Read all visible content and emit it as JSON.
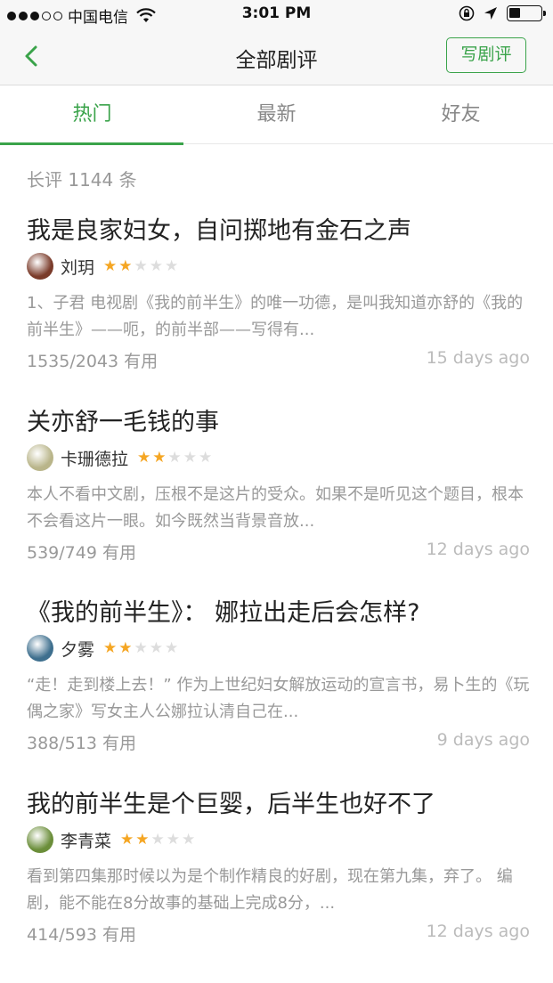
{
  "status_bar": {
    "carrier": "中国电信",
    "time": "3:01 PM",
    "battery_level": 0.35
  },
  "nav": {
    "title": "全部剧评",
    "write_label": "写剧评",
    "back_icon": "chevron-left-icon"
  },
  "tabs": [
    {
      "label": "热门"
    },
    {
      "label": "最新"
    },
    {
      "label": "好友"
    }
  ],
  "review_count": "长评 1144 条",
  "reviews": [
    {
      "title": "我是良家妇女，自问掷地有金石之声",
      "author": "刘玥",
      "rating": 2,
      "snippet": "1、子君 电视剧《我的前半生》的唯一功德，是叫我知道亦舒的《我的前半生》——呃，的前半部——写得有...",
      "useful": "1535/2043 有用",
      "time": "15 days ago",
      "avatar_color": "#7a3b2a"
    },
    {
      "title": "关亦舒一毛钱的事",
      "author": "卡珊德拉",
      "rating": 2,
      "snippet": "本人不看中文剧，压根不是这片的受众。如果不是听见这个题目，根本不会看这片一眼。如今既然当背景音放...",
      "useful": "539/749 有用",
      "time": "12 days ago",
      "avatar_color": "#b9b58a"
    },
    {
      "title": "《我的前半生》： 娜拉出走后会怎样?",
      "author": "夕雾",
      "rating": 2,
      "snippet": "“走！走到楼上去！” 作为上世纪妇女解放运动的宣言书，易卜生的《玩偶之家》写女主人公娜拉认清自己在...",
      "useful": "388/513 有用",
      "time": "9 days ago",
      "avatar_color": "#3e6f8e"
    },
    {
      "title": "我的前半生是个巨婴，后半生也好不了",
      "author": "李青菜",
      "rating": 2,
      "snippet": "看到第四集那时候以为是个制作精良的好剧，现在第九集，弃了。 编剧，能不能在8分故事的基础上完成8分，...",
      "useful": "414/593 有用",
      "time": "12 days ago",
      "avatar_color": "#6b8e3a"
    }
  ]
}
